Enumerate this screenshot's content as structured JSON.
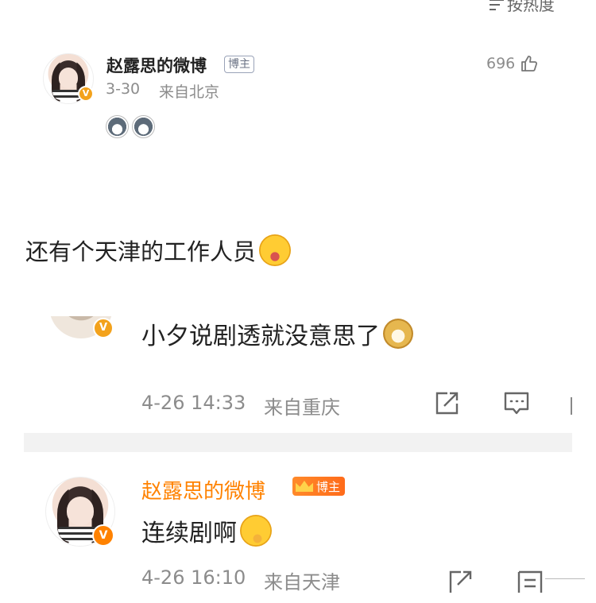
{
  "sort_bar": {
    "label": "按热度"
  },
  "post": {
    "username": "赵露思的微博",
    "tag": "博主",
    "date": "3-30",
    "location": "来自北京",
    "likes": "696"
  },
  "main_text": "还有个天津的工作人员",
  "comment1": {
    "text": "小夕说剧透就没意思了",
    "time": "4-26 14:33",
    "location": "来自重庆"
  },
  "comment2": {
    "username": "赵露思的微博",
    "tag": "博主",
    "text": "连续剧啊",
    "time": "4-26 16:10",
    "location": "来自天津"
  },
  "colors": {
    "orange_name": "#ff8200",
    "meta_gray": "#8c8c8c",
    "badge_orange": "#f3a21c"
  },
  "icons": {
    "sort": "sort-icon",
    "like": "thumbs-up-icon",
    "repost": "repost-icon",
    "comment": "comment-icon"
  }
}
